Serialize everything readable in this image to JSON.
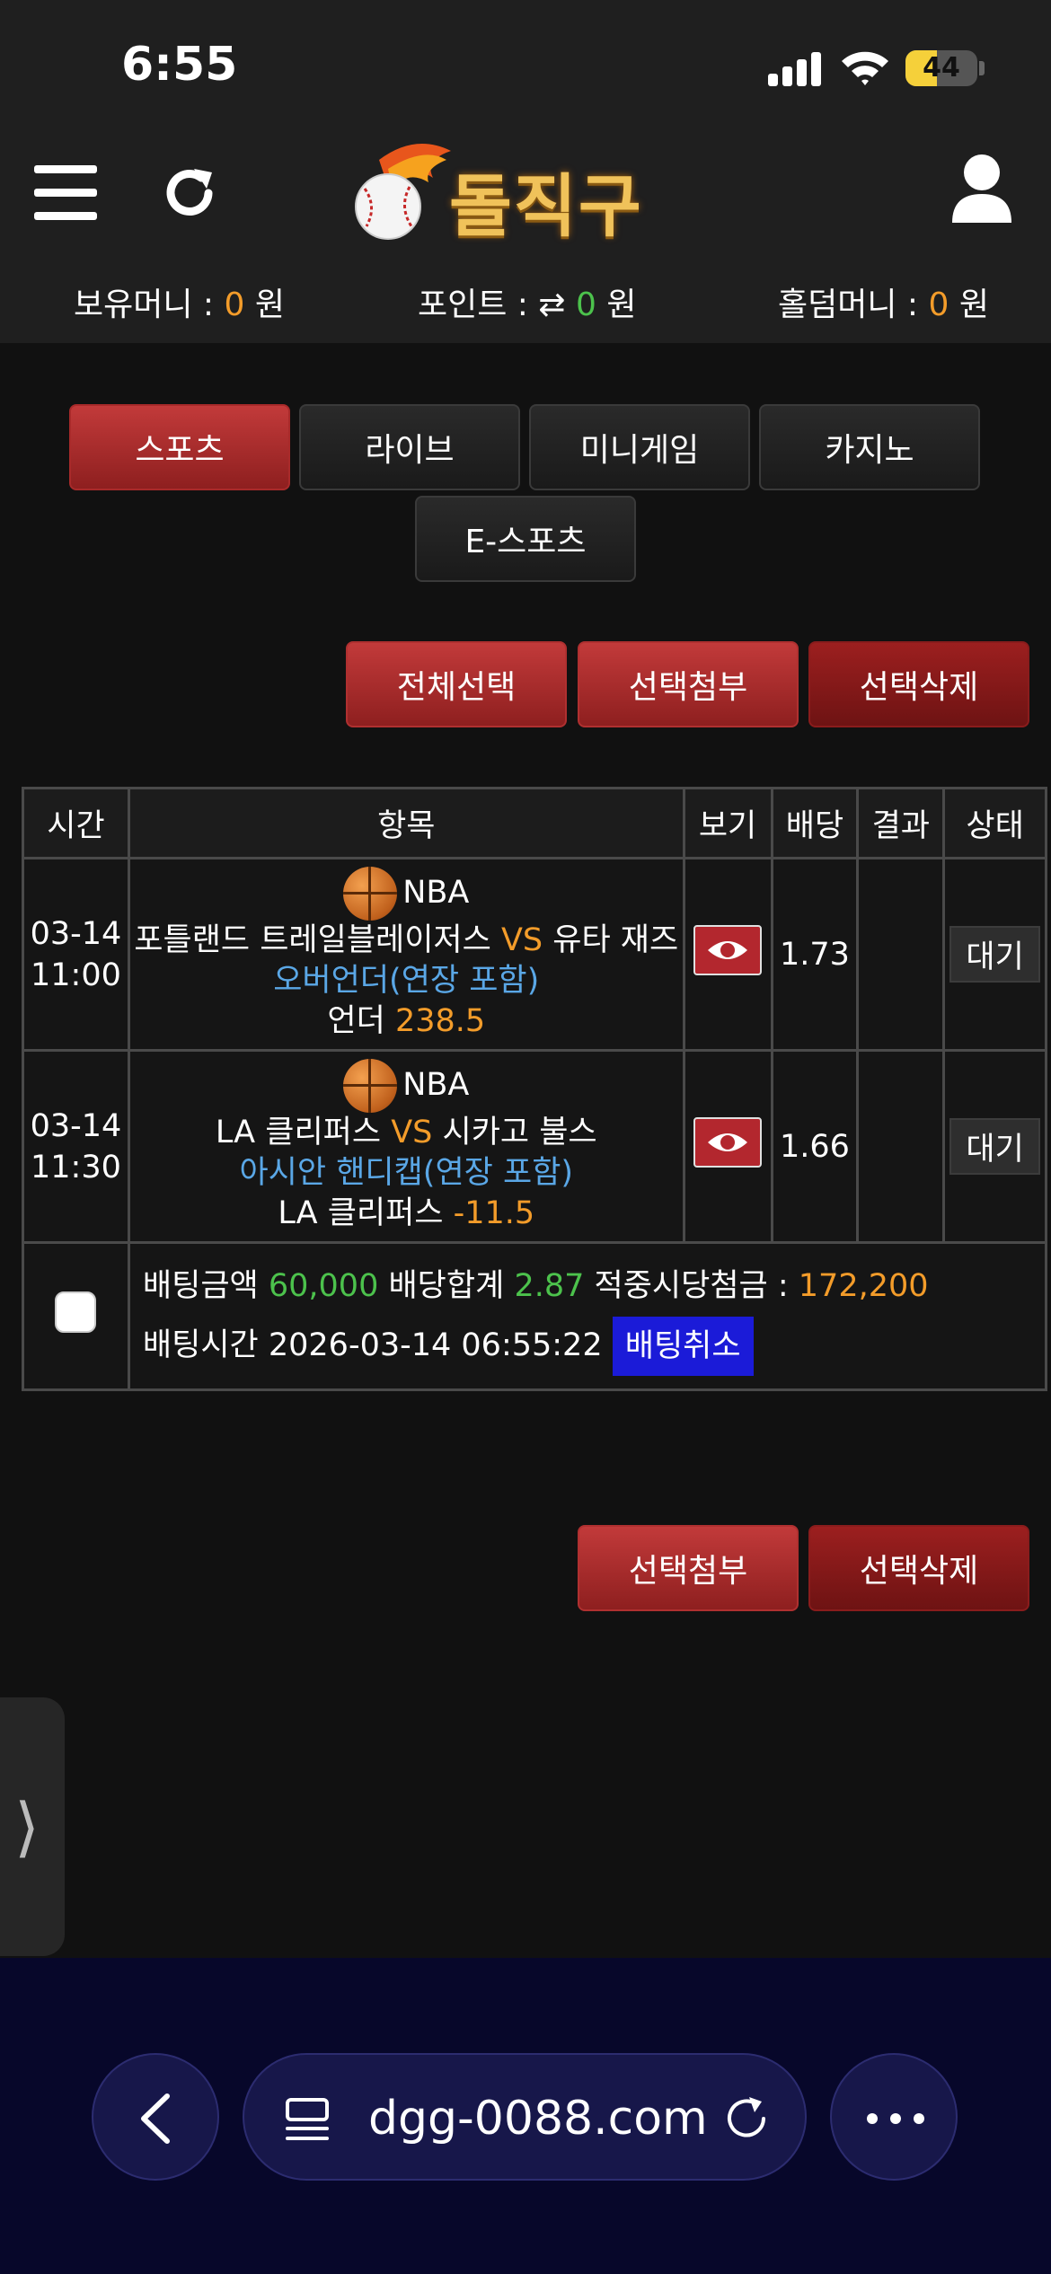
{
  "status": {
    "time": "6:55",
    "battery": "44",
    "battery_pct": 0.44
  },
  "header": {
    "logo_text": "돌직구",
    "balances": [
      {
        "label": "보유머니 : ",
        "value": "0",
        "unit": " 원"
      },
      {
        "label": "포인트 : ",
        "icon": "⇄",
        "value": "0",
        "unit": " 원"
      },
      {
        "label": "홀덤머니 : ",
        "value": "0",
        "unit": " 원"
      }
    ]
  },
  "tabs": [
    {
      "label": "스포츠",
      "active": true
    },
    {
      "label": "라이브",
      "active": false
    },
    {
      "label": "미니게임",
      "active": false
    },
    {
      "label": "카지노",
      "active": false
    },
    {
      "label": "E-스포츠",
      "active": false
    }
  ],
  "actions_top": {
    "select_all": "전체선택",
    "attach": "선택첨부",
    "delete": "선택삭제"
  },
  "table": {
    "headers": {
      "time": "시간",
      "item": "항목",
      "view": "보기",
      "odds": "배당",
      "result": "결과",
      "state": "상태"
    },
    "rows": [
      {
        "date": "03-14",
        "time": "11:00",
        "league": "NBA",
        "home": "포틀랜드 트레일블레이저스",
        "vs": "VS",
        "away": "유타 재즈",
        "market": "오버언더(연장 포함)",
        "pick": "언더",
        "line": "238.5",
        "odds": "1.73",
        "result": "",
        "state": "대기"
      },
      {
        "date": "03-14",
        "time": "11:30",
        "league": "NBA",
        "home": "LA 클리퍼스",
        "vs": "VS",
        "away": "시카고 불스",
        "market": "아시안 핸디캡(연장 포함)",
        "pick": "LA 클리퍼스",
        "line": "-11.5",
        "odds": "1.66",
        "result": "",
        "state": "대기"
      }
    ],
    "summary": {
      "amount_label": "배팅금액",
      "amount": "60,000",
      "odds_label": "배당합계",
      "odds_total": "2.87",
      "payout_label": "적중시당첨금 :",
      "payout": "172,200",
      "time_label": "배팅시간",
      "time": "2026-03-14 06:55:22",
      "cancel_label": "배팅취소"
    }
  },
  "actions_bottom": {
    "attach": "선택첨부",
    "delete": "선택삭제"
  },
  "side_handle": {
    "glyph": "⟩"
  },
  "browser": {
    "url": "dgg-0088.com"
  }
}
